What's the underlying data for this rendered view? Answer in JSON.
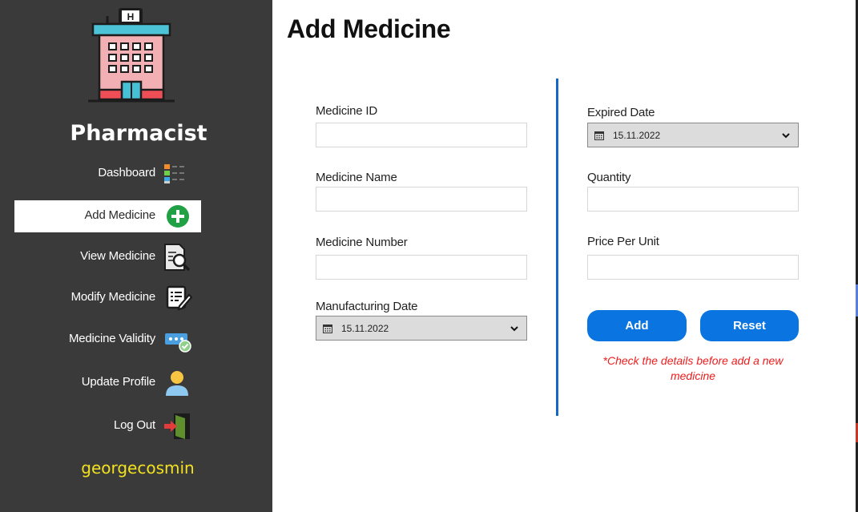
{
  "sidebar": {
    "role_title": "Pharmacist",
    "username": "georgecosmin",
    "username_color": "#f2e11f",
    "logo_icon": "hospital-building-icon",
    "items": [
      {
        "label": "Dashboard",
        "icon": "dashboard-icon"
      },
      {
        "label": "Add Medicine",
        "icon": "add-circle-icon",
        "active": true
      },
      {
        "label": "View Medicine",
        "icon": "document-search-icon"
      },
      {
        "label": "Modify Medicine",
        "icon": "edit-list-icon"
      },
      {
        "label": "Medicine Validity",
        "icon": "password-check-icon"
      },
      {
        "label": "Update Profile",
        "icon": "user-profile-icon"
      },
      {
        "label": "Log Out",
        "icon": "logout-door-icon"
      }
    ]
  },
  "main": {
    "title": "Add Medicine",
    "left_fields": {
      "medicine_id": {
        "label": "Medicine ID",
        "value": ""
      },
      "medicine_name": {
        "label": "Medicine Name",
        "value": ""
      },
      "medicine_number": {
        "label": "Medicine Number",
        "value": ""
      },
      "manufacturing_date": {
        "label": "Manufacturing Date",
        "value": "15.11.2022"
      }
    },
    "right_fields": {
      "expired_date": {
        "label": "Expired Date",
        "value": "15.11.2022"
      },
      "quantity": {
        "label": "Quantity",
        "value": ""
      },
      "price_per_unit": {
        "label": "Price Per Unit",
        "value": ""
      }
    },
    "buttons": {
      "add": "Add",
      "reset": "Reset"
    },
    "note": "*Check the details before add a new medicine"
  },
  "colors": {
    "sidebar_bg": "#3a3a3a",
    "accent_blue": "#0a75e0",
    "divider": "#1466c8",
    "note_red": "#ee1c1c"
  }
}
